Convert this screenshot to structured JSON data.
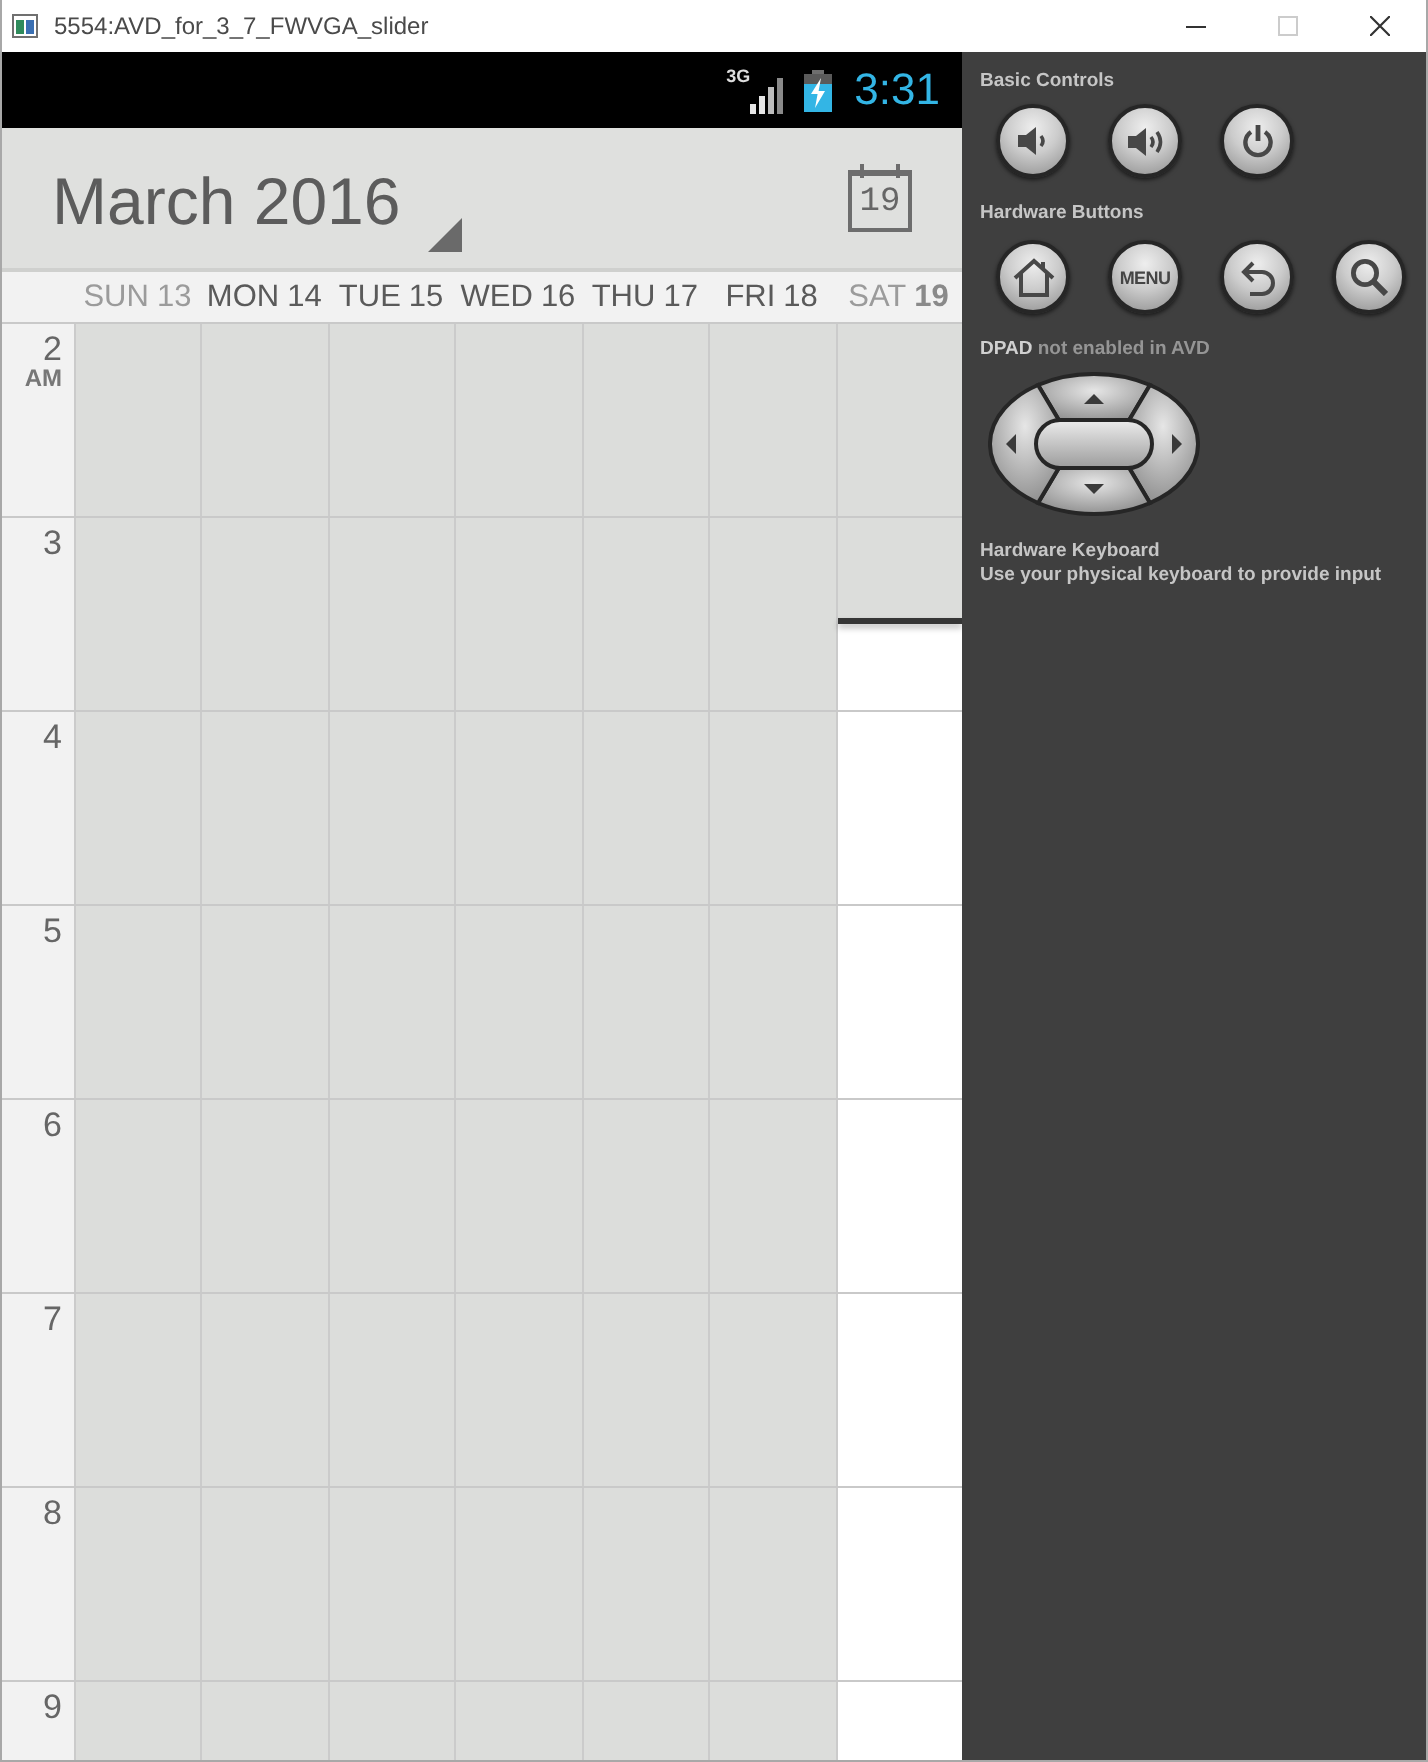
{
  "window": {
    "title": "5554:AVD_for_3_7_FWVGA_slider",
    "controls": [
      {
        "kind": "minimize",
        "disabled": false
      },
      {
        "kind": "maximize",
        "disabled": true
      },
      {
        "kind": "close",
        "disabled": false
      }
    ]
  },
  "status_bar": {
    "network": "3G",
    "time": "3:31"
  },
  "calendar": {
    "title": "March 2016",
    "today_button": "19",
    "days": [
      {
        "weekday": "SUN",
        "date": "13",
        "weekend": true,
        "today": false,
        "past": true
      },
      {
        "weekday": "MON",
        "date": "14",
        "weekend": false,
        "today": false,
        "past": true
      },
      {
        "weekday": "TUE",
        "date": "15",
        "weekend": false,
        "today": false,
        "past": true
      },
      {
        "weekday": "WED",
        "date": "16",
        "weekend": false,
        "today": false,
        "past": true
      },
      {
        "weekday": "THU",
        "date": "17",
        "weekend": false,
        "today": false,
        "past": true
      },
      {
        "weekday": "FRI",
        "date": "18",
        "weekend": false,
        "today": false,
        "past": true
      },
      {
        "weekday": "SAT",
        "date": "19",
        "weekend": true,
        "today": true,
        "past": false
      }
    ],
    "hours": [
      {
        "label": "2",
        "suffix": "AM",
        "current": false
      },
      {
        "label": "3",
        "current": true
      },
      {
        "label": "4",
        "current": false
      },
      {
        "label": "5",
        "current": false
      },
      {
        "label": "6",
        "current": false
      },
      {
        "label": "7",
        "current": false
      },
      {
        "label": "8",
        "current": false
      },
      {
        "label": "9",
        "current": false
      }
    ]
  },
  "controls_panel": {
    "sections": [
      {
        "title": "Basic Controls",
        "buttons": [
          {
            "kind": "volume_down"
          },
          {
            "kind": "volume_up"
          },
          {
            "kind": "power"
          }
        ]
      },
      {
        "title": "Hardware Buttons",
        "buttons": [
          {
            "kind": "home"
          },
          {
            "kind": "menu",
            "label": "MENU"
          },
          {
            "kind": "back"
          },
          {
            "kind": "search"
          }
        ]
      }
    ],
    "dpad_note": "**DPAD** not enabled in AVD",
    "keyboard": {
      "title": "Hardware Keyboard",
      "note": "Use your physical keyboard to provide input"
    }
  }
}
